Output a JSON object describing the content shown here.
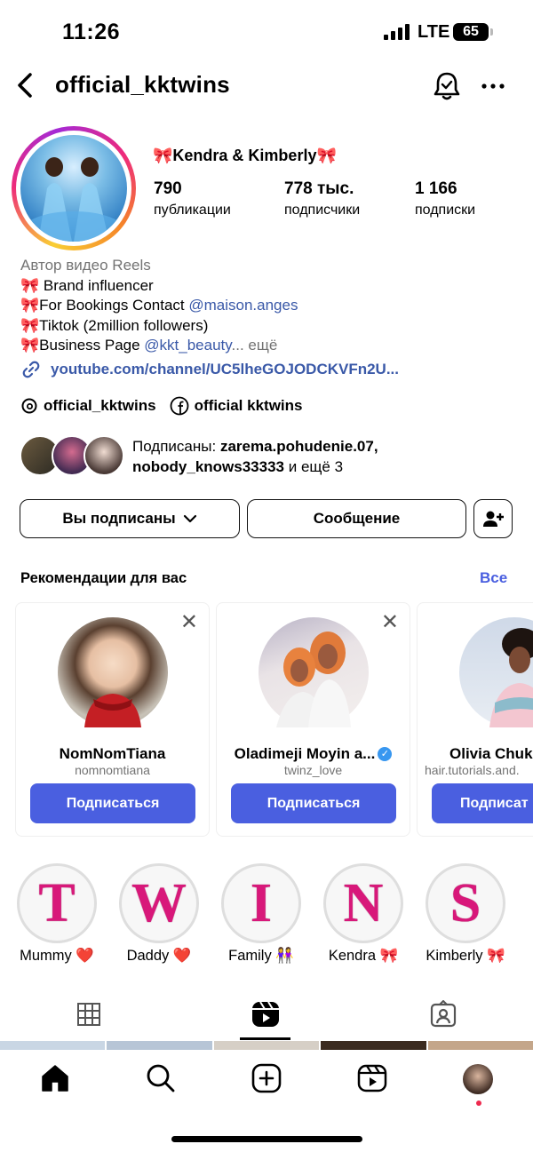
{
  "status_bar": {
    "time": "11:26",
    "network": "LTE",
    "battery": "65"
  },
  "header": {
    "username": "official_kktwins"
  },
  "profile": {
    "display_name": "🎀Kendra & Kimberly🎀",
    "stats": [
      {
        "value": "790",
        "label": "публикации"
      },
      {
        "value": "778 тыс.",
        "label": "подписчики"
      },
      {
        "value": "1 166",
        "label": "подписки"
      }
    ],
    "category": "Автор видео Reels",
    "bio_lines": [
      {
        "text": "🎀 Brand influencer",
        "mention": ""
      },
      {
        "text": "🎀For Bookings Contact ",
        "mention": "@maison.anges"
      },
      {
        "text": "🎀Tiktok (2million followers)",
        "mention": ""
      },
      {
        "text": "🎀Business Page ",
        "mention": "@kkt_beauty"
      }
    ],
    "more_label": "... ещё",
    "link": "youtube.com/channel/UC5lheGOJODCKVFn2U...",
    "threads": "official_kktwins",
    "facebook": "official kktwins",
    "followed_by_prefix": "Подписаны: ",
    "followed_by_names_1": "zarema.pohudenie.07,",
    "followed_by_names_2": "nobody_knows33333",
    "followed_by_suffix": " и ещё 3"
  },
  "actions": {
    "following": "Вы подписаны",
    "message": "Сообщение"
  },
  "recommendations": {
    "title": "Рекомендации для вас",
    "all_label": "Все",
    "cards": [
      {
        "name": "NomNomTiana",
        "handle": "nomnomtiana",
        "button": "Подписаться"
      },
      {
        "name": "Oladimeji Moyin a...",
        "handle": "twinz_love",
        "button": "Подписаться"
      },
      {
        "name": "Olivia Chuk",
        "handle": "hair.tutorials.and.",
        "button": "Подписат"
      }
    ]
  },
  "highlights": [
    {
      "letter": "T",
      "label": "Mummy ❤️"
    },
    {
      "letter": "W",
      "label": "Daddy ❤️"
    },
    {
      "letter": "I",
      "label": "Family 👭"
    },
    {
      "letter": "N",
      "label": "Kendra 🎀"
    },
    {
      "letter": "S",
      "label": "Kimberly 🎀"
    }
  ],
  "colors": {
    "accent": "#4a5fe0",
    "mention": "#3a59a8",
    "highlight_letter": "#d8187a"
  }
}
